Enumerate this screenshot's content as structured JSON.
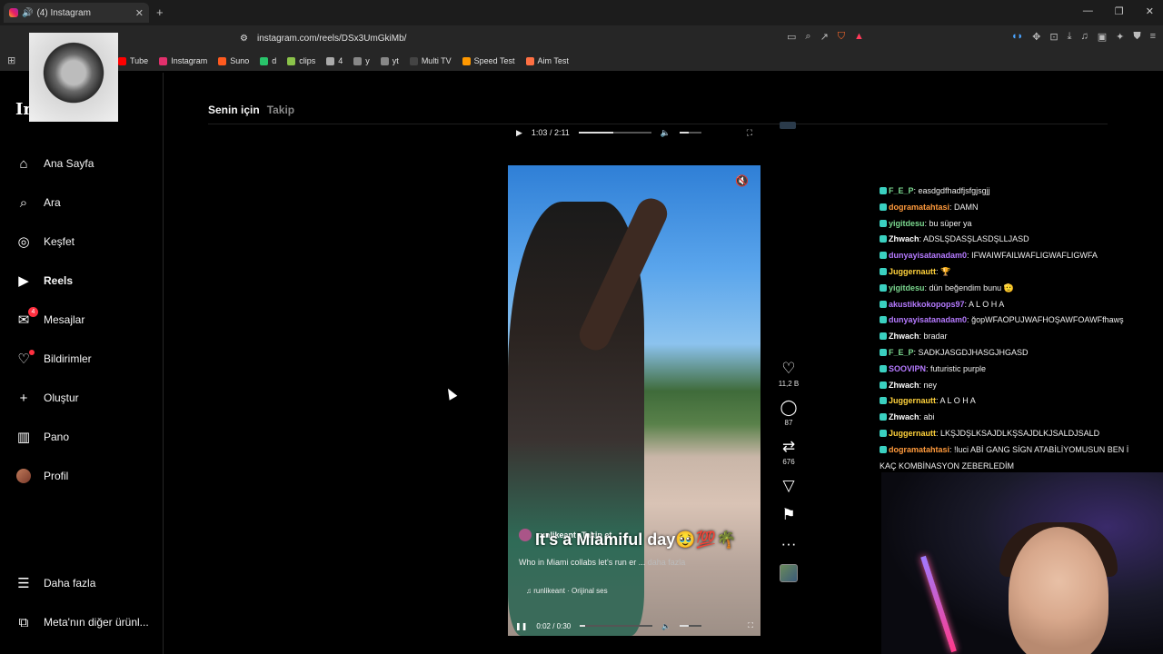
{
  "browser": {
    "tab_title": "(4) Instagram",
    "url": "instagram.com/reels/DSx3UmGkiMb/",
    "bookmarks": [
      {
        "label": "Tube",
        "color": "#ff0000"
      },
      {
        "label": "Instagram",
        "color": "#e1306c"
      },
      {
        "label": "Suno",
        "color": "#ff5a1f"
      },
      {
        "label": "d",
        "color": "#29c46b"
      },
      {
        "label": "clips",
        "color": "#8bc34a"
      },
      {
        "label": "4",
        "color": "#aaaaaa"
      },
      {
        "label": "y",
        "color": "#888888"
      },
      {
        "label": "yt",
        "color": "#888888"
      },
      {
        "label": "Multi TV",
        "color": "#444444"
      },
      {
        "label": "Speed Test",
        "color": "#ff9800"
      },
      {
        "label": "Aim Test",
        "color": "#ff7043"
      }
    ]
  },
  "sidebar": {
    "logo": "In",
    "items": [
      {
        "label": "Ana Sayfa",
        "icon": "home-icon"
      },
      {
        "label": "Ara",
        "icon": "search-icon"
      },
      {
        "label": "Keşfet",
        "icon": "compass-icon"
      },
      {
        "label": "Reels",
        "icon": "reels-icon"
      },
      {
        "label": "Mesajlar",
        "icon": "messenger-icon",
        "badge": "4"
      },
      {
        "label": "Bildirimler",
        "icon": "heart-icon"
      },
      {
        "label": "Oluştur",
        "icon": "plus-icon"
      },
      {
        "label": "Pano",
        "icon": "dashboard-icon"
      },
      {
        "label": "Profil",
        "icon": "avatar"
      }
    ],
    "more": "Daha fazla",
    "meta": "Meta'nın diğer ürünl..."
  },
  "main": {
    "tab_for_you": "Senin için",
    "tab_following": "Takip",
    "top_time": "1:03 / 2:11",
    "top_progress": 0.48
  },
  "reel": {
    "username": "runlikeant",
    "follow": "Takip et",
    "overlay_text": "It's a Miamiful day🥹💯🌴",
    "caption": "Who in Miami collabs let's run er ...",
    "more": "daha fazla",
    "audio": "runlikeant · Orijinal ses",
    "time": "0:02 / 0:30",
    "progress": 0.07
  },
  "actions": {
    "likes": "11,2 B",
    "comments": "87",
    "reposts": "676"
  },
  "chat": [
    {
      "user": "F_E_P",
      "color": "#7bd88f",
      "text": "easdgdfhadfjsfgjsgjj"
    },
    {
      "user": "dogramatahtasi",
      "color": "#ff9a3c",
      "text": "DAMN"
    },
    {
      "user": "yigitdesu",
      "color": "#7bd88f",
      "text": "bu süper ya"
    },
    {
      "user": "Zhwach",
      "color": "#ffffff",
      "text": "ADSLŞDASŞLASDŞLLJASD"
    },
    {
      "user": "dunyayisatanadam0",
      "color": "#b57aff",
      "text": "IFWAIWFAILWAFLIGWAFLIGWFA"
    },
    {
      "user": "Juggernautt",
      "color": "#ffd23c",
      "text": "🏆"
    },
    {
      "user": "yigitdesu",
      "color": "#7bd88f",
      "text": "dün beğendim bunu 🫡"
    },
    {
      "user": "akustikkokopops97",
      "color": "#b57aff",
      "text": "A L O H A"
    },
    {
      "user": "dunyayisatanadam0",
      "color": "#b57aff",
      "text": "ğopWFAOPUJWAFHOŞAWFOAWFfhawş"
    },
    {
      "user": "Zhwach",
      "color": "#ffffff",
      "text": "bradar"
    },
    {
      "user": "F_E_P",
      "color": "#7bd88f",
      "text": "SADKJASGDJHASGJHGASD"
    },
    {
      "user": "SOOVIPN",
      "color": "#b57aff",
      "text": "futuristic purple"
    },
    {
      "user": "Zhwach",
      "color": "#ffffff",
      "text": "ney"
    },
    {
      "user": "Juggernautt",
      "color": "#ffd23c",
      "text": "A L O H A"
    },
    {
      "user": "Zhwach",
      "color": "#ffffff",
      "text": "abi"
    },
    {
      "user": "Juggernautt",
      "color": "#ffd23c",
      "text": "LKŞJDŞLKSAJDLKŞSAJDLKJSALDJSALD"
    },
    {
      "user": "dogramatahtasi",
      "color": "#ff9a3c",
      "text": "!luci ABİ GANG SİGN ATABİLİYOMUSUN BEN İ"
    },
    {
      "user": "",
      "color": "#ffffff",
      "text": "KAÇ KOMBİNASYON ZEBERLEDİM"
    }
  ]
}
